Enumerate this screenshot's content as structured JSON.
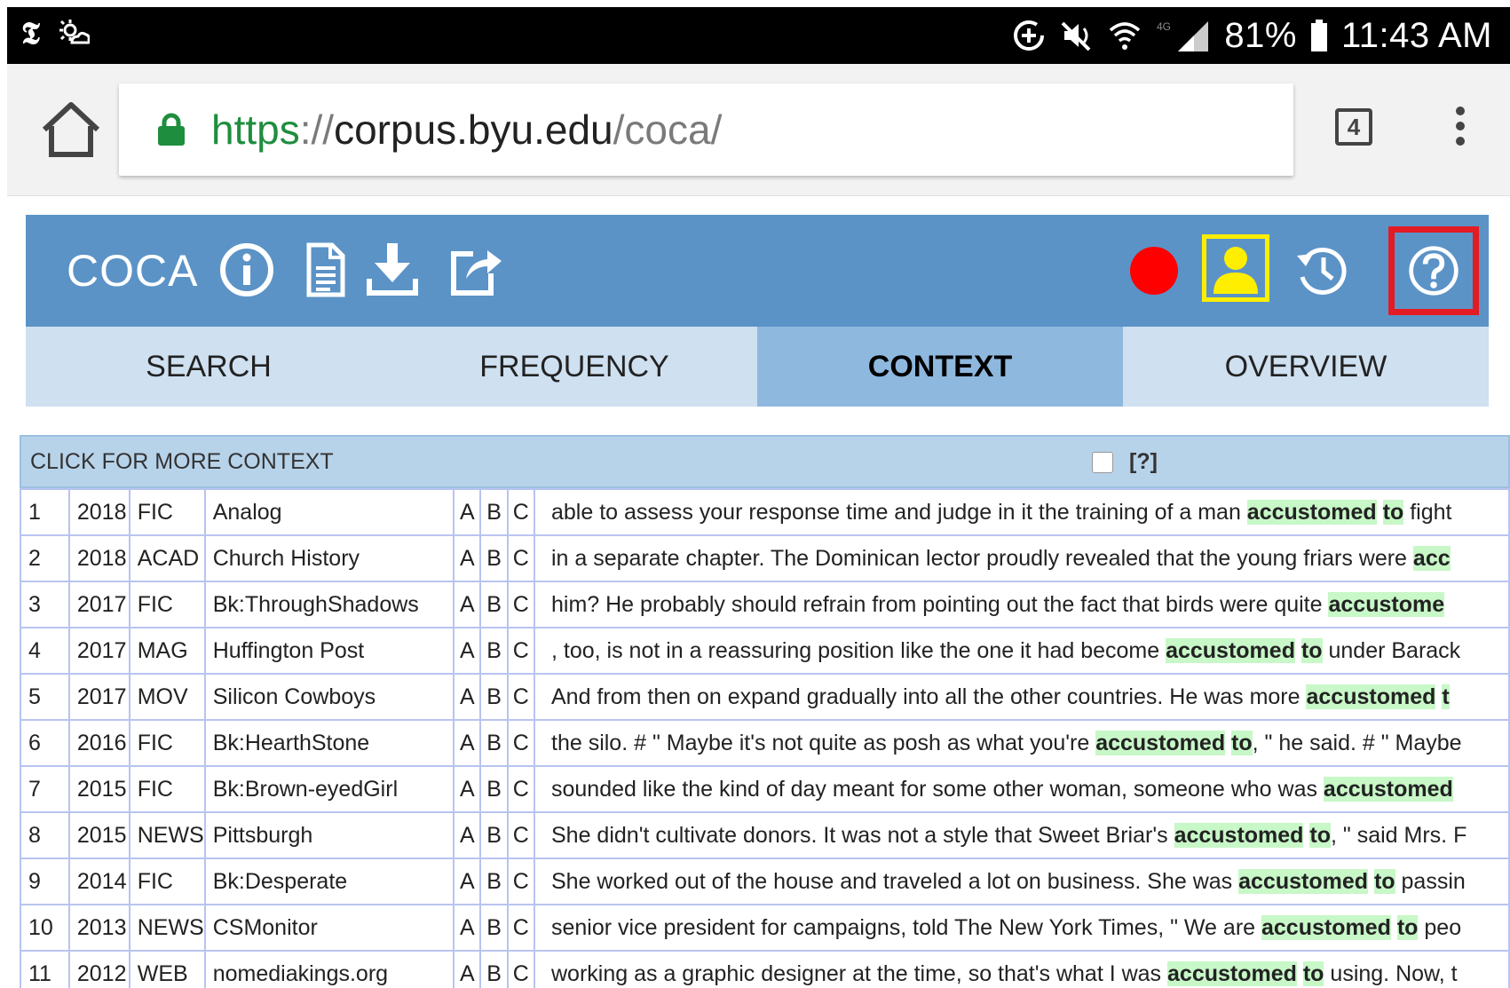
{
  "status_bar": {
    "battery": "81%",
    "time": "11:43 AM",
    "left_icons": [
      "nyt-icon",
      "weather-icon"
    ],
    "right_icons": [
      "data-saver-icon",
      "mute-icon",
      "wifi-icon",
      "signal-icon",
      "battery-icon"
    ]
  },
  "browser": {
    "url_scheme": "https",
    "url_sep": "://",
    "url_host": "corpus.byu.edu",
    "url_path": "/coca/",
    "tab_count": "4"
  },
  "header": {
    "title": "COCA",
    "icons": [
      "info-icon",
      "document-icon",
      "download-icon",
      "share-icon",
      "record-icon",
      "user-icon",
      "history-icon",
      "help-icon"
    ]
  },
  "tabs": [
    {
      "label": "SEARCH",
      "active": false
    },
    {
      "label": "FREQUENCY",
      "active": false
    },
    {
      "label": "CONTEXT",
      "active": true
    },
    {
      "label": "OVERVIEW",
      "active": false
    }
  ],
  "results": {
    "header_label": "CLICK FOR MORE CONTEXT",
    "help_label": "[?]",
    "rows": [
      {
        "num": "1",
        "year": "2018",
        "genre": "FIC",
        "source": "Analog",
        "a": "A",
        "b": "B",
        "c": "C",
        "pre": "able to assess your response time and judge in it the training of a man ",
        "kw1": "accustomed",
        "kw2": "to",
        "post": " fight"
      },
      {
        "num": "2",
        "year": "2018",
        "genre": "ACAD",
        "source": "Church History",
        "a": "A",
        "b": "B",
        "c": "C",
        "pre": "in a separate chapter. The Dominican lector proudly revealed that the young friars were ",
        "kw1": "acc",
        "kw2": "",
        "post": ""
      },
      {
        "num": "3",
        "year": "2017",
        "genre": "FIC",
        "source": "Bk:ThroughShadows",
        "a": "A",
        "b": "B",
        "c": "C",
        "pre": "him? He probably should refrain from pointing out the fact that birds were quite ",
        "kw1": "accustome",
        "kw2": "",
        "post": ""
      },
      {
        "num": "4",
        "year": "2017",
        "genre": "MAG",
        "source": "Huffington Post",
        "a": "A",
        "b": "B",
        "c": "C",
        "pre": ", too, is not in a reassuring position like the one it had become ",
        "kw1": "accustomed",
        "kw2": "to",
        "post": " under Barack"
      },
      {
        "num": "5",
        "year": "2017",
        "genre": "MOV",
        "source": "Silicon Cowboys",
        "a": "A",
        "b": "B",
        "c": "C",
        "pre": "And from then on expand gradually into all the other countries. He was more ",
        "kw1": "accustomed",
        "kw2": "t",
        "post": ""
      },
      {
        "num": "6",
        "year": "2016",
        "genre": "FIC",
        "source": "Bk:HearthStone",
        "a": "A",
        "b": "B",
        "c": "C",
        "pre": "the silo. # \" Maybe it's not quite as posh as what you're ",
        "kw1": "accustomed",
        "kw2": "to",
        "post": ", \" he said. # \" Maybe"
      },
      {
        "num": "7",
        "year": "2015",
        "genre": "FIC",
        "source": "Bk:Brown-eyedGirl",
        "a": "A",
        "b": "B",
        "c": "C",
        "pre": "sounded like the kind of day meant for some other woman, someone who was ",
        "kw1": "accustomed",
        "kw2": "",
        "post": ""
      },
      {
        "num": "8",
        "year": "2015",
        "genre": "NEWS",
        "source": "Pittsburgh",
        "a": "A",
        "b": "B",
        "c": "C",
        "pre": "She didn't cultivate donors. It was not a style that Sweet Briar's ",
        "kw1": "accustomed",
        "kw2": "to",
        "post": ", \" said Mrs. F"
      },
      {
        "num": "9",
        "year": "2014",
        "genre": "FIC",
        "source": "Bk:Desperate",
        "a": "A",
        "b": "B",
        "c": "C",
        "pre": "She worked out of the house and traveled a lot on business. She was ",
        "kw1": "accustomed",
        "kw2": "to",
        "post": " passin"
      },
      {
        "num": "10",
        "year": "2013",
        "genre": "NEWS",
        "source": "CSMonitor",
        "a": "A",
        "b": "B",
        "c": "C",
        "pre": "senior vice president for campaigns, told The New York Times, \" We are ",
        "kw1": "accustomed",
        "kw2": "to",
        "post": " peo"
      },
      {
        "num": "11",
        "year": "2012",
        "genre": "WEB",
        "source": "nomediakings.org",
        "a": "A",
        "b": "B",
        "c": "C",
        "pre": "working as a graphic designer at the time, so that's what I was ",
        "kw1": "accustomed",
        "kw2": "to",
        "post": " using. Now, t"
      }
    ]
  },
  "colors": {
    "header_blue": "#5b93c7",
    "tab_bg": "#cfe0f0",
    "tab_active": "#8fb8de",
    "highlight": "#c8f7c8",
    "help_outline": "#e31b23",
    "user_outline": "#ffee00",
    "record_red": "#ff0000"
  }
}
